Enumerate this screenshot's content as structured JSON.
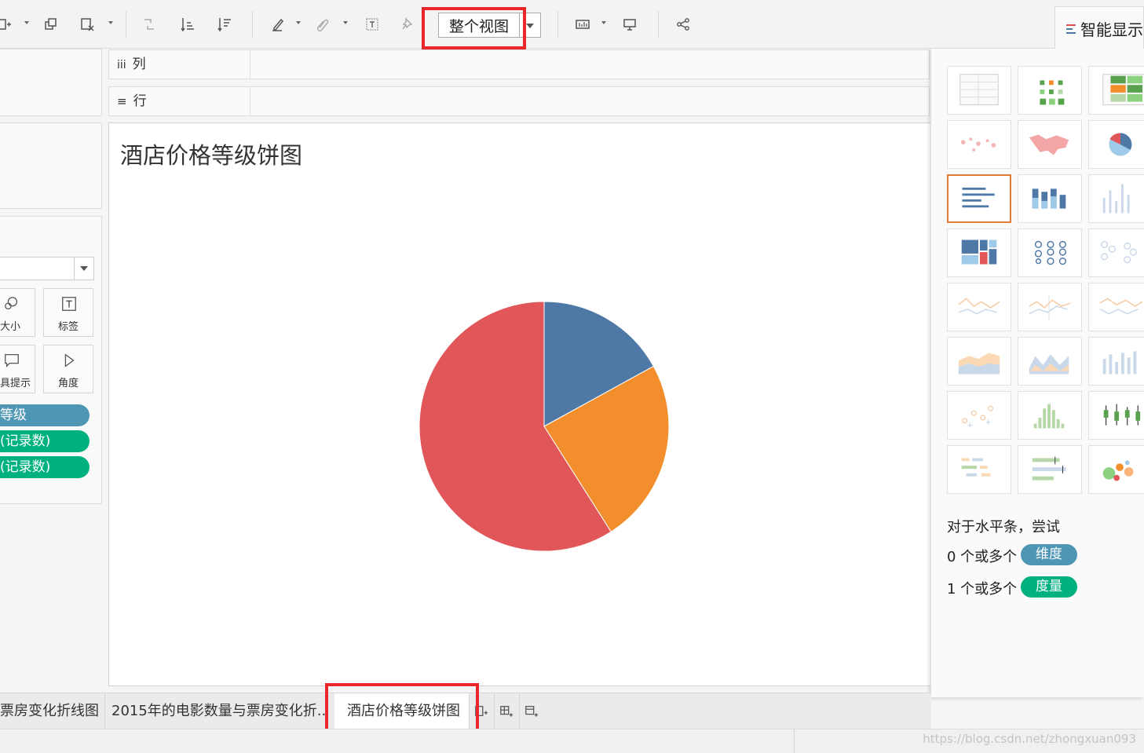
{
  "toolbar": {
    "fit_label": "整个视图",
    "showme_label": "智能显示"
  },
  "shelves": {
    "columns_label": "列",
    "rows_label": "行"
  },
  "marks": {
    "size_label": "大小",
    "label_label": "标签",
    "tooltip_label": "具提示",
    "angle_label": "角度",
    "pills": [
      {
        "text": "等级",
        "color": "#4f96b5"
      },
      {
        "text": "(记录数)",
        "color": "#00b180"
      },
      {
        "text": "(记录数)",
        "color": "#00b180"
      }
    ]
  },
  "view": {
    "title": "酒店价格等级饼图"
  },
  "chart_data": {
    "type": "pie",
    "values": [
      17,
      24,
      59
    ],
    "colors": [
      "#4e79a7",
      "#f28e2b",
      "#e15759"
    ]
  },
  "showme": {
    "hint": "对于水平条，尝试",
    "dim_prefix": "0 个或多个",
    "dim_pill": "维度",
    "mea_prefix": "1 个或多个",
    "mea_pill": "度量",
    "dim_color": "#4f96b5",
    "mea_color": "#00b180"
  },
  "tabs": [
    "票房变化折线图",
    "2015年的电影数量与票房变化折...",
    "酒店价格等级饼图"
  ],
  "watermark": "https://blog.csdn.net/zhongxuan093"
}
